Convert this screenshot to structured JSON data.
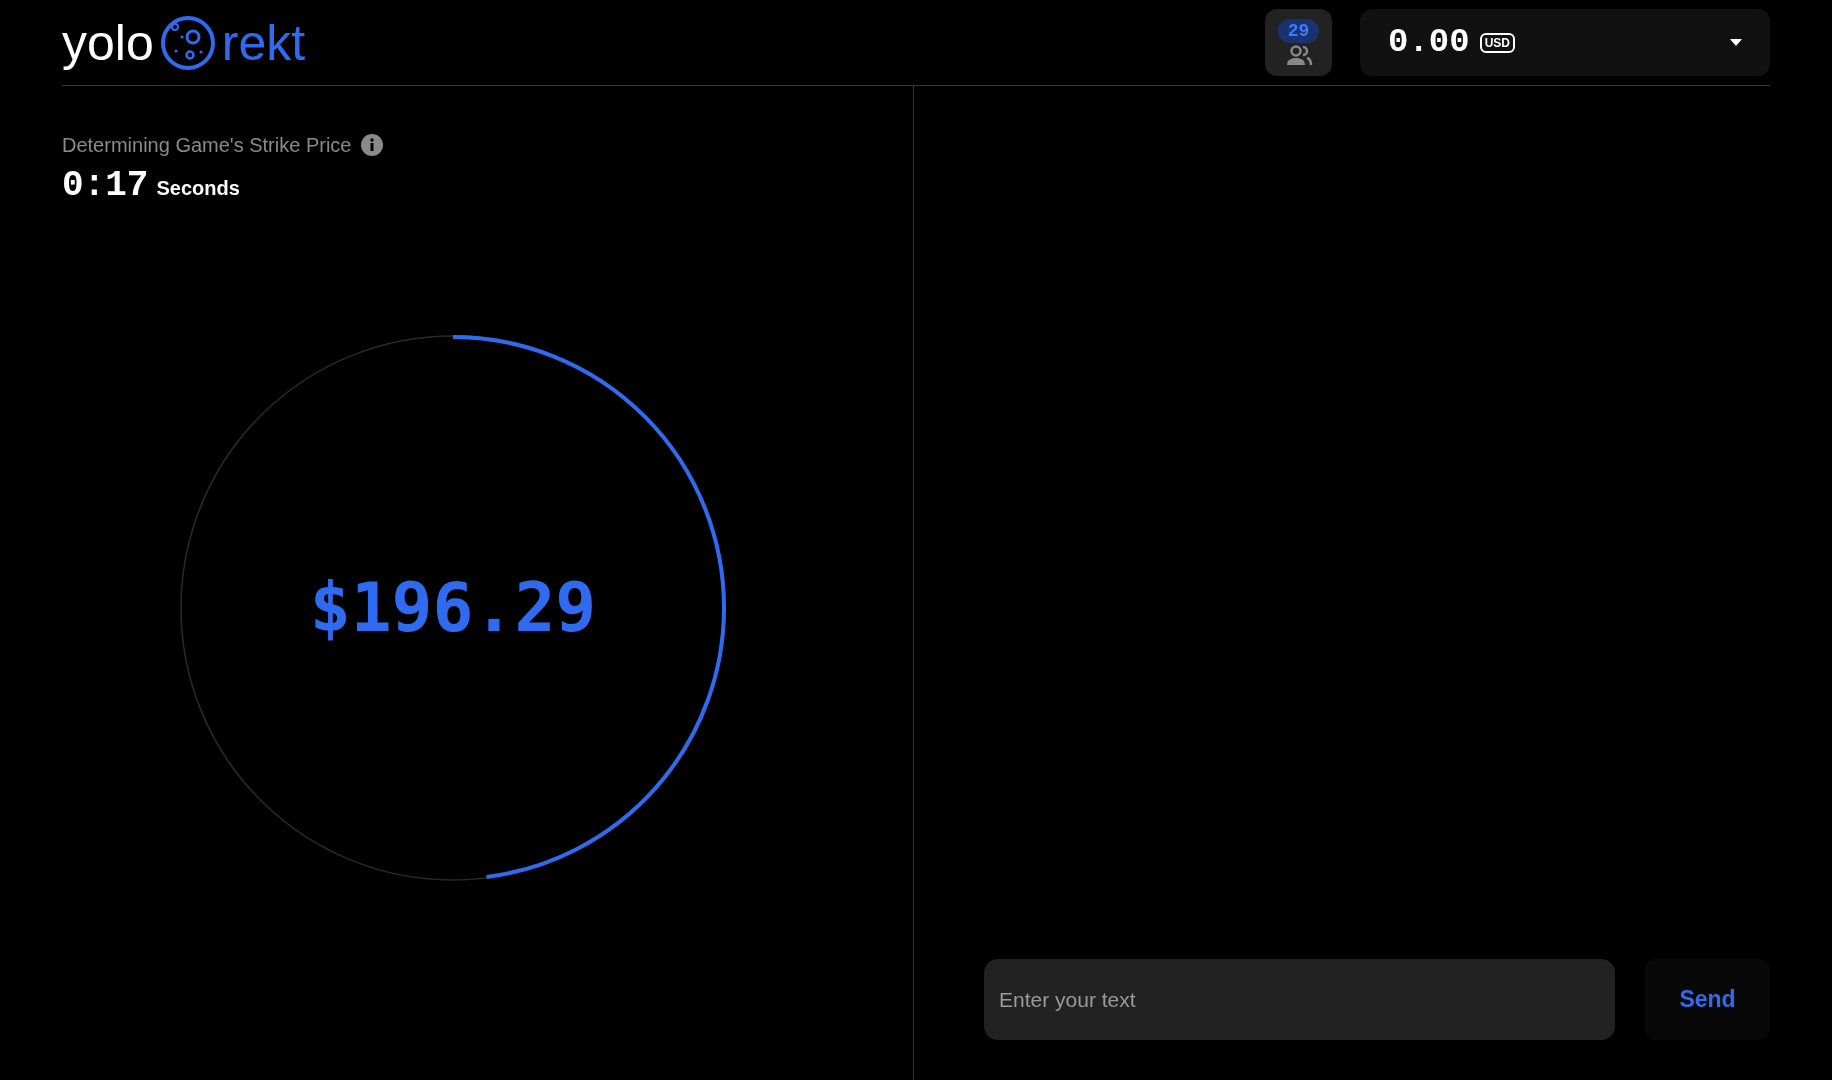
{
  "logo": {
    "left": "yolo",
    "right": "rekt"
  },
  "players": {
    "count": "29"
  },
  "balance": {
    "amount": "0.00",
    "currency": "USD"
  },
  "game": {
    "title": "Determining Game's Strike Price",
    "timer": "0:17",
    "timer_unit": "Seconds",
    "price": "$196.29",
    "level": 0.48
  },
  "chat": {
    "placeholder": "Enter your text",
    "send": "Send"
  }
}
